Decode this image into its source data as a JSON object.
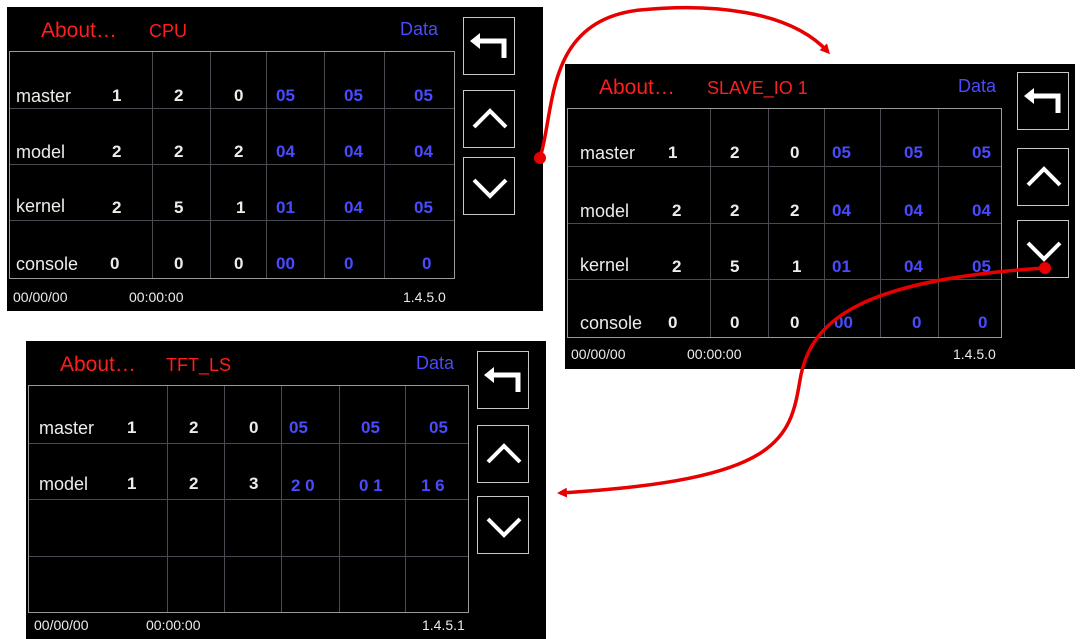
{
  "panels": [
    {
      "about": "About…",
      "device": "CPU",
      "data_label": "Data",
      "rows": [
        {
          "label": "master",
          "values": [
            "1",
            "2",
            "0",
            "05",
            "05",
            "05"
          ]
        },
        {
          "label": "model",
          "values": [
            "2",
            "2",
            "2",
            "04",
            "04",
            "04"
          ]
        },
        {
          "label": "kernel",
          "values": [
            "2",
            "5",
            "1",
            "01",
            "04",
            "05"
          ]
        },
        {
          "label": "console",
          "values": [
            "0",
            "0",
            "0",
            "00",
            "0",
            "0"
          ]
        }
      ],
      "date": "00/00/00",
      "time": "00:00:00",
      "version": "1.4.5.0"
    },
    {
      "about": "About…",
      "device": "SLAVE_IO 1",
      "data_label": "Data",
      "rows": [
        {
          "label": "master",
          "values": [
            "1",
            "2",
            "0",
            "05",
            "05",
            "05"
          ]
        },
        {
          "label": "model",
          "values": [
            "2",
            "2",
            "2",
            "04",
            "04",
            "04"
          ]
        },
        {
          "label": "kernel",
          "values": [
            "2",
            "5",
            "1",
            "01",
            "04",
            "05"
          ]
        },
        {
          "label": "console",
          "values": [
            "0",
            "0",
            "0",
            "00",
            "0",
            "0"
          ]
        }
      ],
      "date": "00/00/00",
      "time": "00:00:00",
      "version": "1.4.5.0"
    },
    {
      "about": "About…",
      "device": "TFT_LS",
      "data_label": "Data",
      "rows": [
        {
          "label": "master",
          "values": [
            "1",
            "2",
            "0",
            "05",
            "05",
            "05"
          ]
        },
        {
          "label": "model",
          "values": [
            "1",
            "2",
            "3",
            "2 0",
            "0 1",
            "1 6"
          ]
        },
        {
          "label": "",
          "values": [
            "",
            "",
            "",
            "",
            "",
            ""
          ]
        },
        {
          "label": "",
          "values": [
            "",
            "",
            "",
            "",
            "",
            ""
          ]
        }
      ],
      "date": "00/00/00",
      "time": "00:00:00",
      "version": "1.4.5.1"
    }
  ],
  "colors": {
    "title": "#ff1e1e",
    "data_label": "#4a4aff",
    "value_white": "#ececec",
    "value_blue": "#4a4aff",
    "flow_arrow": "#e60000"
  },
  "icons": [
    "return-arrow-icon",
    "chevron-up-icon",
    "chevron-down-icon"
  ]
}
